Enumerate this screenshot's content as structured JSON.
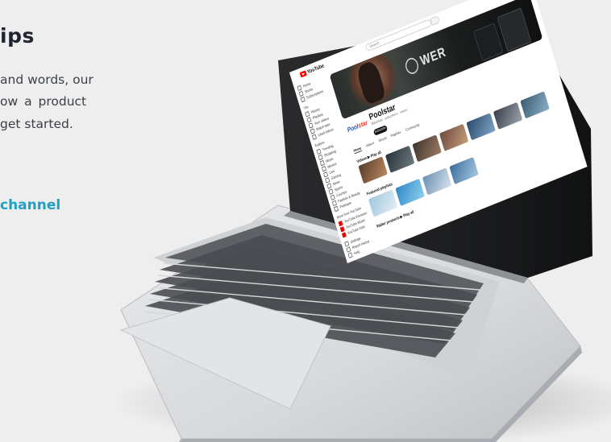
{
  "copy": {
    "title": "ips",
    "line1": "and words, our",
    "line2": "ow a product",
    "line3": "get started.",
    "link": "channel"
  },
  "youtube": {
    "logo_text": "YouTube",
    "search_placeholder": "Search",
    "sidebar": [
      {
        "label": "Home"
      },
      {
        "label": "Shorts"
      },
      {
        "label": "Subscriptions"
      },
      {
        "label": "You"
      },
      {
        "label": "History"
      },
      {
        "label": "Playlists"
      },
      {
        "label": "Your videos"
      },
      {
        "label": "Watch later"
      },
      {
        "label": "Liked videos"
      },
      {
        "label": "Explore"
      },
      {
        "label": "Trending"
      },
      {
        "label": "Shopping"
      },
      {
        "label": "Music"
      },
      {
        "label": "Movies"
      },
      {
        "label": "Live"
      },
      {
        "label": "Gaming"
      },
      {
        "label": "News"
      },
      {
        "label": "Sports"
      },
      {
        "label": "Courses"
      },
      {
        "label": "Fashion & Beauty"
      },
      {
        "label": "Podcasts"
      },
      {
        "label": "More from YouTube"
      },
      {
        "label": "YouTube Premium"
      },
      {
        "label": "YouTube Music"
      },
      {
        "label": "YouTube Kids"
      },
      {
        "label": "Settings"
      },
      {
        "label": "Report history"
      },
      {
        "label": "Help"
      }
    ],
    "banner_text": "WER",
    "channel_logo_main": "Pool",
    "channel_logo_accent": "star",
    "channel_name": "Poolstar",
    "channel_meta": "@poolstar · subscribers · videos",
    "subscribe_label": "Subscribe",
    "tabs": [
      "Home",
      "Videos",
      "Shorts",
      "Playlists",
      "Community"
    ],
    "videos_title": "Videos ▶ Play all",
    "playlists_title": "Featured playlists",
    "more_title": "Walter products ▶ Play all"
  },
  "colors": {
    "accent": "#1ea0c8",
    "youtube_red": "#ff0000",
    "avatar": "#e26a1e"
  }
}
